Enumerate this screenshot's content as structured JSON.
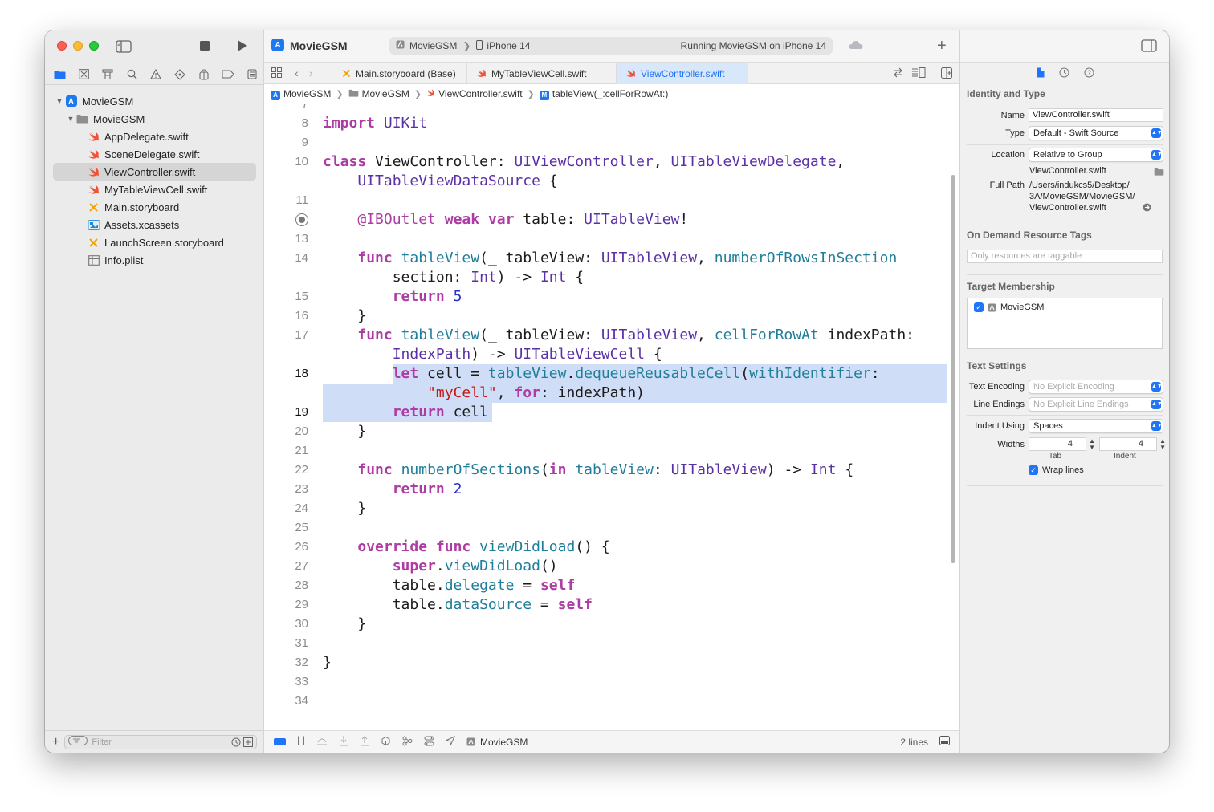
{
  "app": {
    "project_name": "MovieGSM",
    "scheme": "MovieGSM",
    "device": "iPhone 14",
    "status": "Running MovieGSM on iPhone 14"
  },
  "navigator": {
    "items": [
      {
        "label": "MovieGSM",
        "level": 0,
        "icon": "project-icon",
        "disclosure": "open"
      },
      {
        "label": "MovieGSM",
        "level": 1,
        "icon": "folder-icon",
        "disclosure": "open"
      },
      {
        "label": "AppDelegate.swift",
        "level": 2,
        "icon": "swift-file-icon"
      },
      {
        "label": "SceneDelegate.swift",
        "level": 2,
        "icon": "swift-file-icon"
      },
      {
        "label": "ViewController.swift",
        "level": 2,
        "icon": "swift-file-icon",
        "selected": true
      },
      {
        "label": "MyTableViewCell.swift",
        "level": 2,
        "icon": "swift-file-icon"
      },
      {
        "label": "Main.storyboard",
        "level": 2,
        "icon": "storyboard-icon"
      },
      {
        "label": "Assets.xcassets",
        "level": 2,
        "icon": "assets-icon"
      },
      {
        "label": "LaunchScreen.storyboard",
        "level": 2,
        "icon": "storyboard-icon"
      },
      {
        "label": "Info.plist",
        "level": 2,
        "icon": "plist-icon"
      }
    ],
    "filter_placeholder": "Filter"
  },
  "tabs": [
    {
      "label": "Main.storyboard (Base)",
      "icon": "storyboard-icon"
    },
    {
      "label": "MyTableViewCell.swift",
      "icon": "swift-file-icon"
    },
    {
      "label": "ViewController.swift",
      "icon": "swift-file-icon",
      "active": true
    }
  ],
  "jumpbar": [
    "MovieGSM",
    "MovieGSM",
    "ViewController.swift",
    "tableView(_:cellForRowAt:)"
  ],
  "code": {
    "lines": [
      {
        "n": "7",
        "text": ""
      },
      {
        "n": "8",
        "text": "import UIKit"
      },
      {
        "n": "9",
        "text": ""
      },
      {
        "n": "10",
        "text": "class ViewController: UIViewController, UITableViewDelegate,"
      },
      {
        "n": "",
        "text": "    UITableViewDataSource {"
      },
      {
        "n": "11",
        "text": ""
      },
      {
        "n": "",
        "text": "    @IBOutlet weak var table: UITableView!"
      },
      {
        "n": "13",
        "text": ""
      },
      {
        "n": "14",
        "text": "    func tableView(_ tableView: UITableView, numberOfRowsInSection"
      },
      {
        "n": "",
        "text": "        section: Int) -> Int {"
      },
      {
        "n": "15",
        "text": "        return 5"
      },
      {
        "n": "16",
        "text": "    }"
      },
      {
        "n": "17",
        "text": "    func tableView(_ tableView: UITableView, cellForRowAt indexPath:"
      },
      {
        "n": "",
        "text": "        IndexPath) -> UITableViewCell {"
      },
      {
        "n": "18",
        "text": "        let cell = tableView.dequeueReusableCell(withIdentifier:"
      },
      {
        "n": "",
        "text": "            \"myCell\", for: indexPath)"
      },
      {
        "n": "19",
        "text": "        return cell"
      },
      {
        "n": "20",
        "text": "    }"
      },
      {
        "n": "21",
        "text": ""
      },
      {
        "n": "22",
        "text": "    func numberOfSections(in tableView: UITableView) -> Int {"
      },
      {
        "n": "23",
        "text": "        return 2"
      },
      {
        "n": "24",
        "text": "    }"
      },
      {
        "n": "25",
        "text": ""
      },
      {
        "n": "26",
        "text": "    override func viewDidLoad() {"
      },
      {
        "n": "27",
        "text": "        super.viewDidLoad()"
      },
      {
        "n": "28",
        "text": "        table.delegate = self"
      },
      {
        "n": "29",
        "text": "        table.dataSource = self"
      },
      {
        "n": "30",
        "text": "    }"
      },
      {
        "n": "31",
        "text": ""
      },
      {
        "n": "32",
        "text": "}"
      },
      {
        "n": "33",
        "text": ""
      },
      {
        "n": "34",
        "text": ""
      }
    ]
  },
  "debug": {
    "scheme": "MovieGSM",
    "selection_info": "2 lines"
  },
  "inspector": {
    "identity": {
      "title": "Identity and Type",
      "name_label": "Name",
      "name_value": "ViewController.swift",
      "type_label": "Type",
      "type_value": "Default - Swift Source",
      "location_label": "Location",
      "location_value": "Relative to Group",
      "location_file": "ViewController.swift",
      "full_path_label": "Full Path",
      "full_path_line1": "/Users/indukcs5/Desktop/",
      "full_path_line2": "3A/MovieGSM/MovieGSM/",
      "full_path_line3": "ViewController.swift"
    },
    "on_demand": {
      "title": "On Demand Resource Tags",
      "placeholder": "Only resources are taggable"
    },
    "target": {
      "title": "Target Membership",
      "item": "MovieGSM"
    },
    "text_settings": {
      "title": "Text Settings",
      "encoding_label": "Text Encoding",
      "encoding_value": "No Explicit Encoding",
      "endings_label": "Line Endings",
      "endings_value": "No Explicit Line Endings",
      "indent_label": "Indent Using",
      "indent_value": "Spaces",
      "widths_label": "Widths",
      "tab_value": "4",
      "indent_width_value": "4",
      "tab_caption": "Tab",
      "indent_caption": "Indent",
      "wrap_label": "Wrap lines"
    }
  },
  "colors": {
    "accent": "#1f75f5",
    "highlight": "#cfdef6",
    "keyword": "#ad3da4",
    "type": "#5b31a6",
    "string": "#c41a16",
    "number": "#2530c7"
  }
}
